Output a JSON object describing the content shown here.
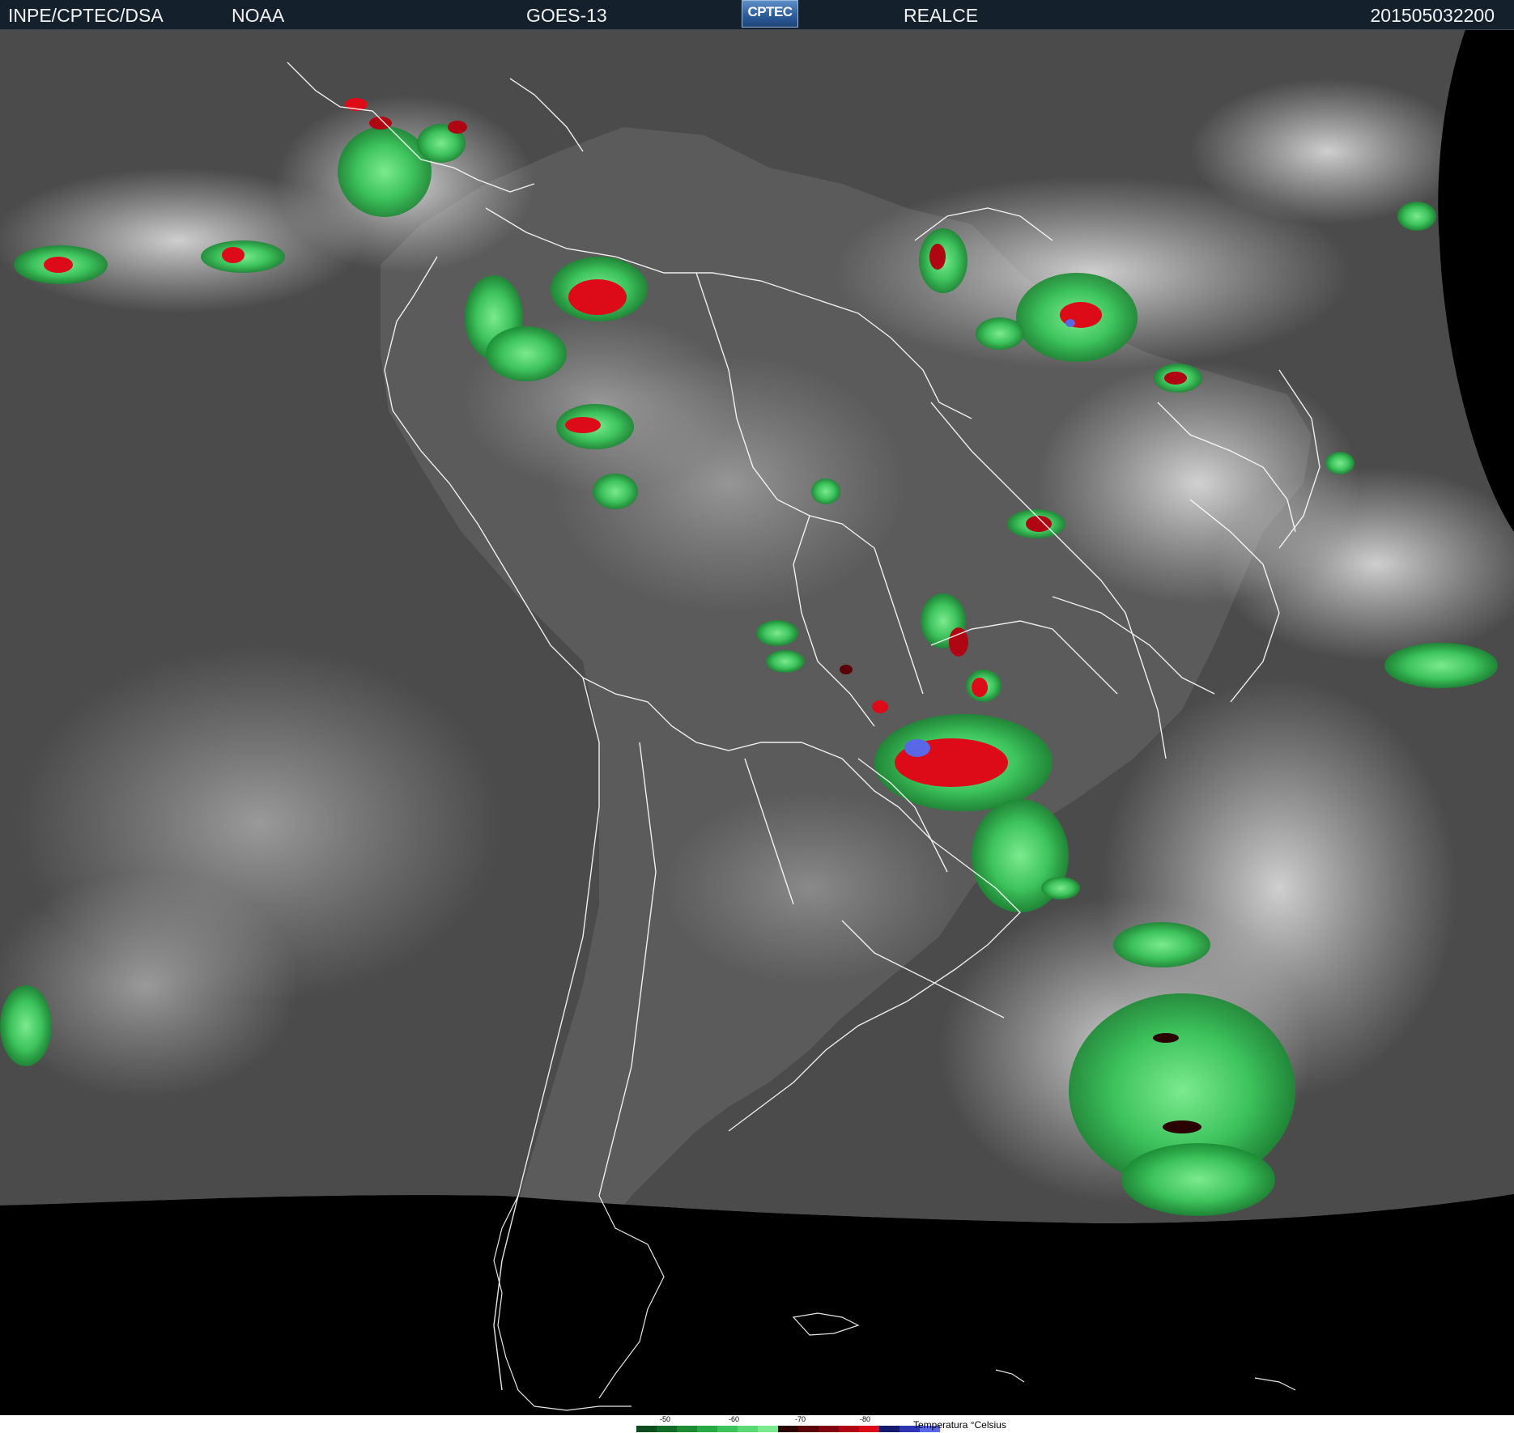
{
  "header": {
    "organization": "INPE/CPTEC/DSA",
    "agency": "NOAA",
    "satellite": "GOES-13",
    "logo_text": "CPTEC",
    "product": "REALCE",
    "timestamp": "201505032200"
  },
  "legend": {
    "title": "Temperatura °Celsius",
    "ticks": [
      "-50",
      "-60",
      "-70",
      "-80"
    ],
    "colors": [
      "#0b4d1c",
      "#126b27",
      "#1b8b34",
      "#27a945",
      "#3dc35c",
      "#59d874",
      "#7cea8f",
      "#2a0000",
      "#5a0208",
      "#82040e",
      "#b00512",
      "#dd0a18",
      "#141a6e",
      "#2c36b0",
      "#5868e6"
    ]
  },
  "map": {
    "background_land_color": "#6e6e6e",
    "ocean_color": "#4a4a4a",
    "space_color": "#000000",
    "border_color": "#ffffff"
  }
}
